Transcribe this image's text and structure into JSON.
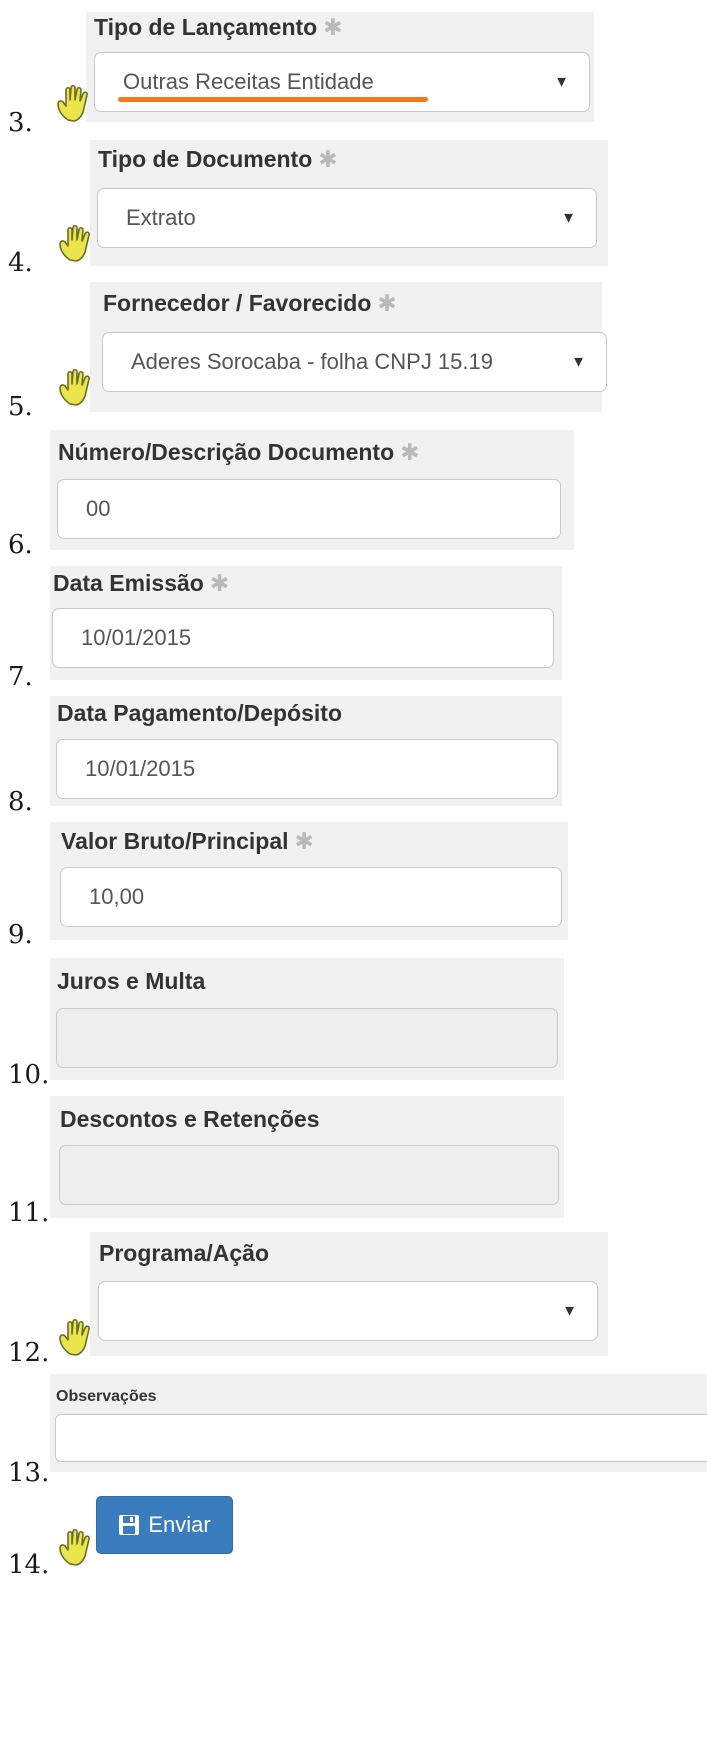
{
  "steps": [
    "3.",
    "4.",
    "5.",
    "6.",
    "7.",
    "8.",
    "9.",
    "10.",
    "11.",
    "12.",
    "13.",
    "14."
  ],
  "required_mark": "✱",
  "fields": {
    "tipo_lancamento": {
      "label": "Tipo de Lançamento",
      "value": "Outras Receitas Entidade"
    },
    "tipo_documento": {
      "label": "Tipo de Documento",
      "value": "Extrato"
    },
    "fornecedor": {
      "label": "Fornecedor / Favorecido",
      "value": "Aderes Sorocaba - folha CNPJ 15.19"
    },
    "numero_documento": {
      "label": "Número/Descrição Documento",
      "value": "00"
    },
    "data_emissao": {
      "label": "Data Emissão",
      "value": "10/01/2015"
    },
    "data_pagamento": {
      "label": "Data Pagamento/Depósito",
      "value": "10/01/2015"
    },
    "valor_bruto": {
      "label": "Valor Bruto/Principal",
      "value": "10,00"
    },
    "juros_multa": {
      "label": "Juros e Multa",
      "value": ""
    },
    "descontos": {
      "label": "Descontos e Retenções",
      "value": ""
    },
    "programa_acao": {
      "label": "Programa/Ação",
      "value": ""
    },
    "observacoes": {
      "label": "Observações",
      "value": ""
    }
  },
  "submit": {
    "label": "Enviar",
    "icon": "save-icon"
  },
  "colors": {
    "highlight": "#f07a1c",
    "button": "#3a7dbf",
    "hand": "#e9e54a"
  }
}
